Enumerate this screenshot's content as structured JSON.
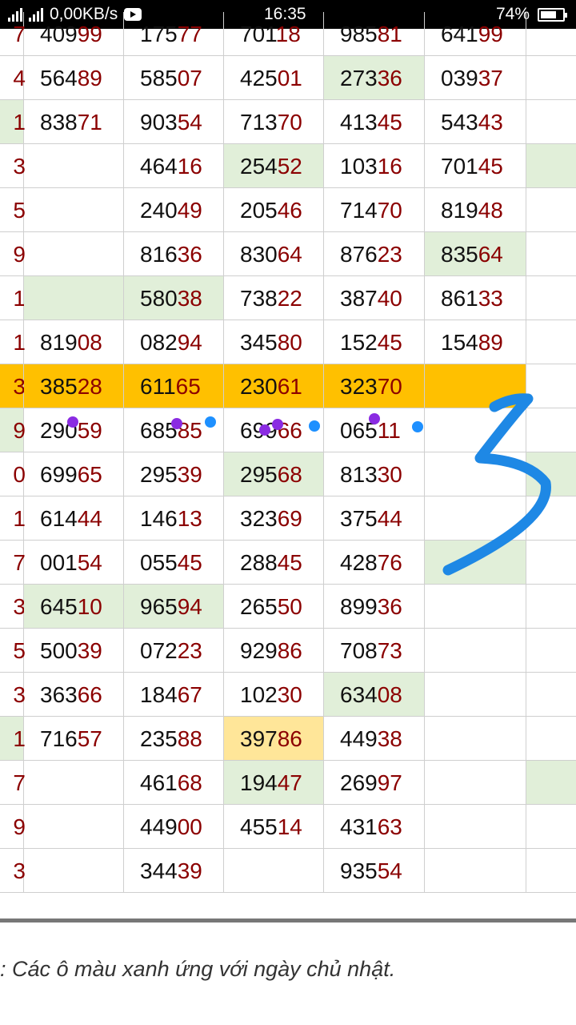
{
  "status": {
    "speed": "0,00KB/s",
    "time": "16:35",
    "battery": "74%",
    "battery_level": 0.74
  },
  "rows": [
    {
      "c0": "7",
      "c1": "40999",
      "c2": "17577",
      "c3": "70118",
      "c4": "98581",
      "c5": "64199",
      "green": [],
      "yellow": []
    },
    {
      "c0": "4",
      "c1": "56489",
      "c2": "58507",
      "c3": "42501",
      "c4": "27336",
      "c5": "03937",
      "green": [
        "c4"
      ],
      "yellow": []
    },
    {
      "c0": "1",
      "c1": "83871",
      "c2": "90354",
      "c3": "71370",
      "c4": "41345",
      "c5": "54343",
      "green": [
        "c0"
      ],
      "yellow": []
    },
    {
      "c0": "3",
      "c1": "",
      "c2": "46416",
      "c3": "25452",
      "c4": "10316",
      "c5": "70145",
      "green": [
        "c3",
        "c6"
      ],
      "yellow": []
    },
    {
      "c0": "5",
      "c1": "",
      "c2": "24049",
      "c3": "20546",
      "c4": "71470",
      "c5": "81948",
      "green": [],
      "yellow": []
    },
    {
      "c0": "9",
      "c1": "",
      "c2": "81636",
      "c3": "83064",
      "c4": "87623",
      "c5": "83564",
      "green": [
        "c5"
      ],
      "yellow": []
    },
    {
      "c0": "1",
      "c1": "",
      "c2": "58038",
      "c3": "73822",
      "c4": "38740",
      "c5": "86133",
      "green": [
        "c1",
        "c2"
      ],
      "yellow": []
    },
    {
      "c0": "1",
      "c1": "81908",
      "c2": "08294",
      "c3": "34580",
      "c4": "15245",
      "c5": "15489",
      "green": [],
      "yellow": []
    },
    {
      "c0": "3",
      "c1": "38528",
      "c2": "61165",
      "c3": "23061",
      "c4": "32370",
      "c5": "",
      "green": [],
      "yellow": [],
      "highlight": true
    },
    {
      "c0": "9",
      "c1": "29059",
      "c2": "68585",
      "c3": "69966",
      "c4": "06511",
      "c5": "",
      "green": [
        "c0"
      ],
      "yellow": []
    },
    {
      "c0": "0",
      "c1": "69965",
      "c2": "29539",
      "c3": "29568",
      "c4": "81330",
      "c5": "",
      "green": [
        "c3",
        "c6"
      ],
      "yellow": []
    },
    {
      "c0": "1",
      "c1": "61444",
      "c2": "14613",
      "c3": "32369",
      "c4": "37544",
      "c5": "",
      "green": [],
      "yellow": []
    },
    {
      "c0": "7",
      "c1": "00154",
      "c2": "05545",
      "c3": "28845",
      "c4": "42876",
      "c5": "",
      "green": [
        "c5"
      ],
      "yellow": []
    },
    {
      "c0": "3",
      "c1": "64510",
      "c2": "96594",
      "c3": "26550",
      "c4": "89936",
      "c5": "",
      "green": [
        "c1",
        "c2"
      ],
      "yellow": []
    },
    {
      "c0": "5",
      "c1": "50039",
      "c2": "07223",
      "c3": "92986",
      "c4": "70873",
      "c5": "",
      "green": [],
      "yellow": []
    },
    {
      "c0": "3",
      "c1": "36366",
      "c2": "18467",
      "c3": "10230",
      "c4": "63408",
      "c5": "",
      "green": [
        "c4"
      ],
      "yellow": []
    },
    {
      "c0": "1",
      "c1": "71657",
      "c2": "23588",
      "c3": "39786",
      "c4": "44938",
      "c5": "",
      "green": [
        "c0"
      ],
      "yellow": [
        "c3"
      ]
    },
    {
      "c0": "7",
      "c1": "",
      "c2": "46168",
      "c3": "19447",
      "c4": "26997",
      "c5": "",
      "green": [
        "c3",
        "c6"
      ],
      "yellow": []
    },
    {
      "c0": "9",
      "c1": "",
      "c2": "44900",
      "c3": "45514",
      "c4": "43163",
      "c5": "",
      "green": [],
      "yellow": []
    },
    {
      "c0": "3",
      "c1": "",
      "c2": "34439",
      "c3": "",
      "c4": "93554",
      "c5": "",
      "green": [],
      "yellow": []
    }
  ],
  "note": ": Các ô màu xanh ứng với ngày chủ nhật.",
  "colors": {
    "green": "#e1efd9",
    "yellow": "#ffe699",
    "highlight": "#ffc000",
    "digit_red": "#8b0000",
    "annotation_blue": "#1e88e5",
    "dot_purple": "#8a2be2"
  }
}
